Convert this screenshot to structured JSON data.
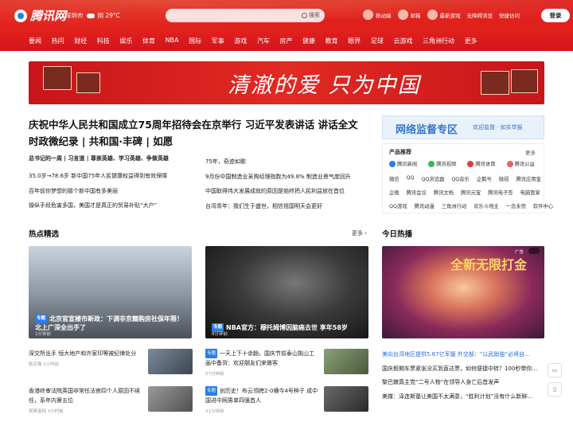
{
  "header": {
    "logo": "腾讯网",
    "city": "深圳市",
    "weather_icon": "cloud-icon",
    "weather": "阴 29°C",
    "search_placeholder": "",
    "search_button": "搜索",
    "links": [
      "移动端",
      "邮箱",
      "最新游戏",
      "无障碍浏览",
      "快捷访问"
    ],
    "login": "登录"
  },
  "nav": [
    "要闻",
    "热问",
    "财经",
    "科技",
    "娱乐",
    "体育",
    "NBA",
    "国际",
    "军事",
    "游戏",
    "汽车",
    "房产",
    "健康",
    "教育",
    "眼界",
    "足球",
    "云游戏",
    "三角洲行动",
    "更多"
  ],
  "banner": {
    "text": "清澈的爱 只为中国"
  },
  "main": {
    "headline": "庆祝中华人民共和国成立75周年招待会在京举行 习近平发表讲话  讲话全文  时政微纪录 | 共和国·丰碑 | 如愿",
    "subhead_left": "总书记的一周 | 习言道 | 尊崇英雄、学习英雄、争做英雄",
    "left_items": [
      "35.0岁→78.6岁 新中国75年人民健康权益得到有效保障",
      "百年前你梦想的那个新中国有多美丽",
      "操纵手段危害多国，美国才是真正的贸易补贴“大户”"
    ],
    "right_items": [
      "75年，奇迹如歌",
      "9月份中国制造业采购经理指数为49.8% 制造业景气度回升",
      "中国取得伟大发展成就的原因是始终把人民利益放在首位",
      "台湾青年：我们生于盛世，相信祖国明天会更好"
    ]
  },
  "promo": {
    "title": "网络监督专区",
    "sub": "欢迎监督 · 如实举报"
  },
  "products": {
    "title": "产品推荐",
    "more": "更多",
    "row1": [
      "腾讯新闻",
      "腾讯视频",
      "腾讯体育",
      "腾讯公益"
    ],
    "row2": [
      "微信",
      "QQ",
      "QQ浏览器",
      "QQ音乐",
      "企鹅号",
      "微视",
      "腾讯应用宝"
    ],
    "row3": [
      "企微",
      "腾讯会议",
      "腾讯文档",
      "腾讯元宝",
      "腾讯电子签",
      "电脑管家"
    ],
    "row4": [
      "QQ游戏",
      "腾讯动漫",
      "三角洲行动",
      "欢乐斗地主",
      "一念永恒",
      "软件中心"
    ]
  },
  "hot_select": {
    "title": "热点精选",
    "more": "更多",
    "card1": {
      "tag": "专题",
      "text": "北京官宣楼市新政：下调非京籍购房社保年限！北上广深全出手了",
      "meta": "1分钟前"
    },
    "card2": {
      "tag": "专题",
      "text": "NBA官方：穆托姆博因脑癌去世 享年58岁",
      "meta": "8分钟前"
    },
    "mini1": {
      "text": "深交所出手 恒大地产和许家印等被纪律处分",
      "meta": "新京报  2小时前"
    },
    "mini2": {
      "tag": "专题",
      "text": "一天上下十余趟，国庆节前泰山挑山工画中备货：欢迎朋友们来做客",
      "meta": "57分钟前"
    },
    "mini3": {
      "text": "香港终审法院英国非常任法官四个人原因不续任，系年内第五位",
      "meta": "观察者网  3小时前"
    },
    "mini4": {
      "tag": "专题",
      "text": "创历史！布云领跨2-0横今4号种子 成中国进中网男单四强首人",
      "meta": "31分钟前"
    }
  },
  "hot_today": {
    "title": "今日热播",
    "ad_title": "全新无限打金",
    "ad_label": "广告",
    "list": [
      "美向台湾地区提供5.67亿军援 外交部：“以武助独”必将自…",
      "国庆假期车票紧张没买到直达票，如何便捷中转？100秒带你…",
      "黎巴嫩真主党“二号人物”在领导人身亡后首发声",
      "美媒：泽连斯基让美国不太满意，“胜利计划”没有什么新鲜…"
    ]
  }
}
